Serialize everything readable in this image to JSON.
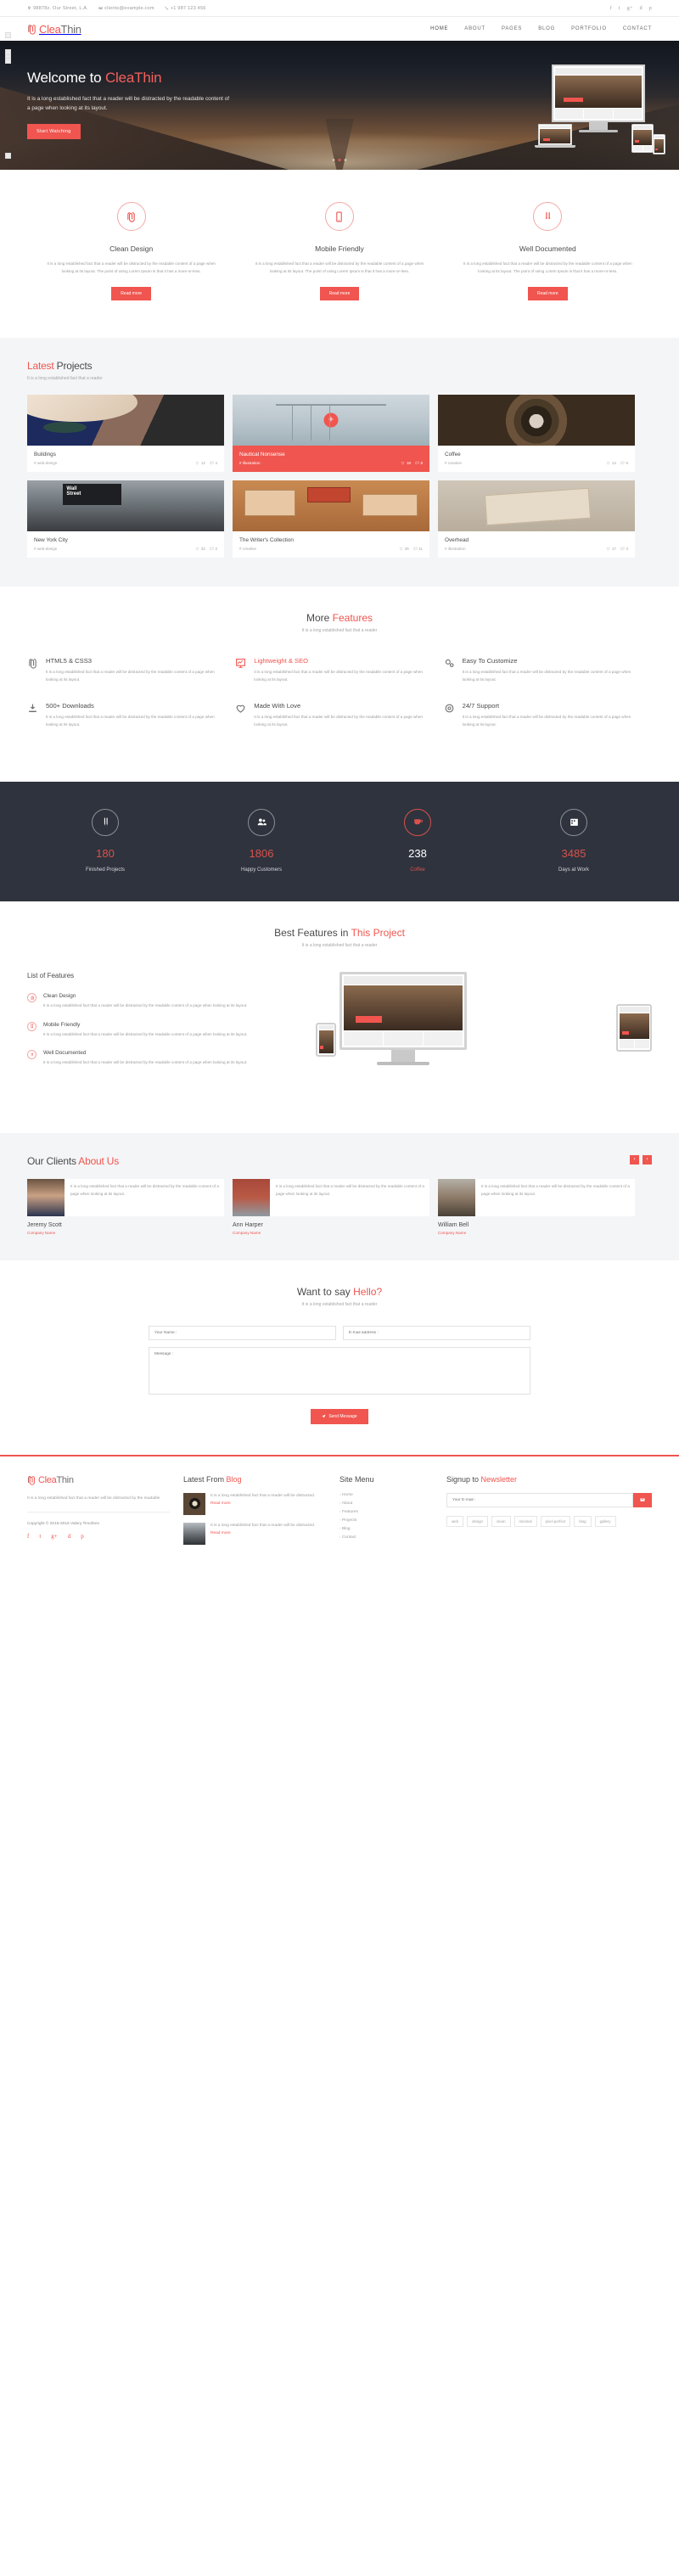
{
  "brand": {
    "part1": "Clea",
    "part2": "Thin"
  },
  "topbar": {
    "address": "98878z. Our Street, L.A.",
    "email": "clients@example.com",
    "phone": "+1 987 123 456",
    "social": [
      "f",
      "t",
      "g+",
      "d",
      "p"
    ]
  },
  "nav": {
    "items": [
      "HOME",
      "ABOUT",
      "PAGES",
      "BLOG",
      "PORTFOLIO",
      "CONTACT"
    ]
  },
  "hero": {
    "title_plain": "Welcome to ",
    "title_accent": "CleaThin",
    "subtitle": "It is a long established fact that a reader will be distracted by the readable content of a page when looking at its layout.",
    "button": "Start Watching",
    "dots": 3,
    "active_dot": 2
  },
  "services": [
    {
      "icon": "paperclip-icon",
      "title": "Clean Design",
      "text": "It is a long established fact that a reader will be distracted by the readable content of a page when looking at its layout. The point of using Lorem Ipsum is that it has a more-or-less.",
      "button": "Read more"
    },
    {
      "icon": "mobile-icon",
      "title": "Mobile Friendly",
      "text": "It is a long established fact that a reader will be distracted by the readable content of a page when looking at its layout. The point of using Lorem Ipsum is that it has a more-or-less.",
      "button": "Read more"
    },
    {
      "icon": "documents-icon",
      "title": "Well Documented",
      "text": "It is a long established fact that a reader will be distracted by the readable content of a page when looking at its layout. The point of using Lorem Ipsum is that it has a more-or-less.",
      "button": "Read more"
    }
  ],
  "projects_section": {
    "title_accent": "Latest",
    "title_plain": " Projects",
    "subtitle": "It is a long established fact that a reader",
    "items": [
      {
        "title": "Buildings",
        "tag": "# web-design",
        "likes": "12",
        "comments": "4",
        "active": false
      },
      {
        "title": "Nautical Nonsense",
        "tag": "# illustration",
        "likes": "18",
        "comments": "8",
        "active": true
      },
      {
        "title": "Coffee",
        "tag": "# creative",
        "likes": "14",
        "comments": "6",
        "active": false
      },
      {
        "title": "New York City",
        "tag": "# web-design",
        "likes": "32",
        "comments": "2",
        "active": false
      },
      {
        "title": "The Writer's Collection",
        "tag": "# creative",
        "likes": "29",
        "comments": "11",
        "active": false
      },
      {
        "title": "Overhead",
        "tag": "# illustration",
        "likes": "17",
        "comments": "3",
        "active": false
      }
    ]
  },
  "features_section": {
    "title_plain": "More ",
    "title_accent": "Features",
    "subtitle": "It is a long established fact that a reader",
    "items": [
      {
        "icon": "paperclip-icon",
        "title": "HTML5 & CSS3",
        "text": "It is a long established fact that a reader will be distracted by the readable content of a page when looking at its layout.",
        "highlight": false
      },
      {
        "icon": "chart-icon",
        "title": "Lightweight & SEO",
        "text": "It is a long established fact that a reader will be distracted by the readable content of a page when looking at its layout.",
        "highlight": true
      },
      {
        "icon": "gears-icon",
        "title": "Easy To Customize",
        "text": "It is a long established fact that a reader will be distracted by the readable content of a page when looking at its layout.",
        "highlight": false
      },
      {
        "icon": "download-icon",
        "title": "500+ Downloads",
        "text": "It is a long established fact that a reader will be distracted by the readable content of a page when looking at its layout.",
        "highlight": false
      },
      {
        "icon": "heart-icon",
        "title": "Made With Love",
        "text": "It is a long established fact that a reader will be distracted by the readable content of a page when looking at its layout.",
        "highlight": false
      },
      {
        "icon": "support-icon",
        "title": "24/7 Support",
        "text": "It is a long established fact that a reader will be distracted by the readable content of a page when looking at its layout.",
        "highlight": false
      }
    ]
  },
  "counters": [
    {
      "icon": "pens-icon",
      "number": "180",
      "label": "Finished Projects",
      "highlight": false
    },
    {
      "icon": "users-icon",
      "number": "1806",
      "label": "Happy Customers",
      "highlight": false
    },
    {
      "icon": "coffee-icon",
      "number": "238",
      "label": "Coffee",
      "highlight": true
    },
    {
      "icon": "calendar-icon",
      "number": "3485",
      "label": "Days at Work",
      "highlight": false
    }
  ],
  "best": {
    "title_plain": "Best Features in ",
    "title_accent": "This Project",
    "subtitle": "It is a long established fact that a reader",
    "list_title": "List of Features",
    "items": [
      {
        "icon": "paperclip-icon",
        "title": "Clean Design",
        "text": "It is a long established fact that a reader will be distracted by the readable content of a page when looking at its layout."
      },
      {
        "icon": "mobile-icon",
        "title": "Mobile Friendly",
        "text": "It is a long established fact that a reader will be distracted by the readable content of a page when looking at its layout."
      },
      {
        "icon": "documents-icon",
        "title": "Well Documented",
        "text": "It is a long established fact that a reader will be distracted by the readable content of a page when looking at its layout."
      }
    ]
  },
  "clients": {
    "title_plain": "Our Clients ",
    "title_accent": "About Us",
    "prev": "‹",
    "next": "›",
    "items": [
      {
        "quote": "It is a long established fact that a reader will be distracted by the readable content of a page when looking at its layout.",
        "name": "Jeremy Scott",
        "company": "Company Name"
      },
      {
        "quote": "It is a long established fact that a reader will be distracted by the readable content of a page when looking at its layout.",
        "name": "Ann Harper",
        "company": "Company Name"
      },
      {
        "quote": "It is a long established fact that a reader will be distracted by the readable content of a page when looking at its layout.",
        "name": "William Bell",
        "company": "Company Name"
      }
    ]
  },
  "contact": {
    "title_plain": "Want to say ",
    "title_accent": "Hello?",
    "subtitle": "It is a long established fact that a reader",
    "name_placeholder": "Your Name :",
    "email_placeholder": "E-mail address :",
    "message_placeholder": "Message :",
    "submit": "Send Message"
  },
  "footer": {
    "about_text": "It is a long established fact that a reader will be distracted by the readable",
    "copyright": "Copyright © 2015-2016 Valery Timofeev",
    "social": [
      "f",
      "t",
      "g+",
      "d",
      "p"
    ],
    "blog": {
      "title_plain": "Latest From ",
      "title_accent": "Blog",
      "items": [
        {
          "text": "It is a long established fact that a reader will be distracted.",
          "link": "Read more"
        },
        {
          "text": "It is a long established fact that a reader will be distracted.",
          "link": "Read more"
        }
      ]
    },
    "menu": {
      "title": "Site Menu",
      "items": [
        "Home",
        "About",
        "Features",
        "Projects",
        "Blog",
        "Contact"
      ]
    },
    "newsletter": {
      "title_plain": "Signup to ",
      "title_accent": "Newsletter",
      "placeholder": "Your E-mail :",
      "tags": [
        "web",
        "design",
        "clean",
        "minimal",
        "pixel perfect",
        "blog",
        "gallery"
      ]
    }
  }
}
